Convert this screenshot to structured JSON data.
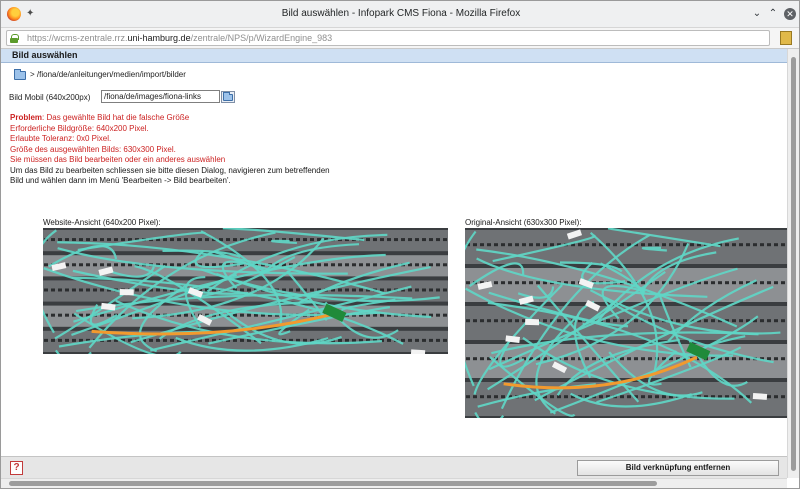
{
  "window": {
    "title": "Bild auswählen - Infopark CMS Fiona - Mozilla Firefox",
    "url_prefix": "https://wcms-zentrale.rrz.",
    "url_host": "uni-hamburg.de",
    "url_path": "/zentrale/NPS/p/WizardEngine_983"
  },
  "header": {
    "title": "Bild auswählen"
  },
  "path": {
    "text": "> /fiona/de/anleitungen/medien/import/bilder"
  },
  "field": {
    "label": "Bild Mobil (640x200px)",
    "value": "/fiona/de/images/fiona-links"
  },
  "message": {
    "problem_label": "Problem",
    "problem_text": ": Das gewählte Bild hat die falsche Größe",
    "lines_red": [
      "Erforderliche Bildgröße: 640x200 Pixel.",
      "Erlaubte Toleranz: 0x0 Pixel.",
      "Größe des ausgewählten Bilds: 630x300 Pixel.",
      "Sie müssen das Bild bearbeiten oder ein anderes auswählen"
    ],
    "lines_black": [
      "Um das Bild zu bearbeiten schliessen sie bitte diesen Dialog, navigieren zum betreffenden",
      "Bild und wählen dann im Menü 'Bearbeiten -> Bild bearbeiten'."
    ]
  },
  "previews": {
    "website_caption": "Website-Ansicht (640x200 Pixel):",
    "original_caption": "Original-Ansicht (630x300 Pixel):"
  },
  "footer": {
    "help_icon_glyph": "?",
    "unlink_label": "Bild verknüpfung entfernen"
  },
  "colors": {
    "header_bg": "#cfe0f3",
    "error_red": "#cc2222",
    "cable_teal": "#5fd6c6",
    "cable_orange": "#f29a2e",
    "cable_green": "#1f8a3a"
  }
}
